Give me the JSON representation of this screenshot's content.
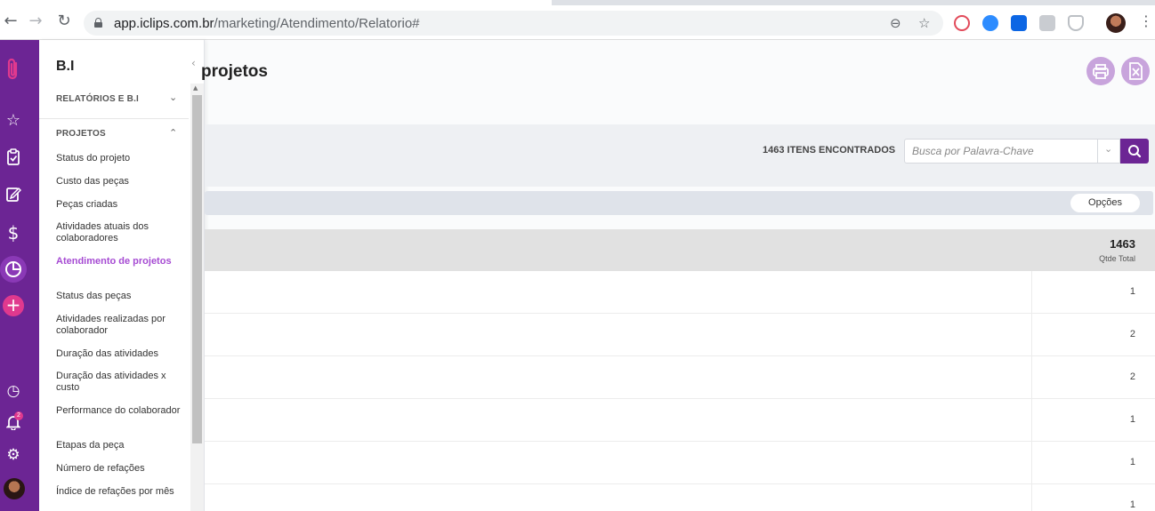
{
  "browser": {
    "url_host": "app.iclips.com.br",
    "url_path": "/marketing/Atendimento/Relatorio#"
  },
  "rail": {
    "icons": [
      "paperclip-logo-icon",
      "star-icon",
      "clipboard-check-icon",
      "edit-icon",
      "dollar-icon",
      "pie-chart-icon",
      "plus-icon",
      "clock-icon",
      "bell-icon",
      "gear-icon",
      "user-avatar"
    ],
    "notifications_count": "2"
  },
  "panel": {
    "title": "B.I",
    "sections": [
      {
        "label": "RELATÓRIOS E B.I"
      },
      {
        "label": "PROJETOS"
      }
    ],
    "items": [
      "Status do projeto",
      "Custo das peças",
      "Peças criadas",
      "Atividades atuais dos colaboradores",
      "Atendimento de projetos",
      "Status das peças",
      "Atividades realizadas por colaborador",
      "Duração das atividades",
      "Duração das atividades x custo",
      "Performance do colaborador",
      "Etapas da peça",
      "Número de refações",
      "Índice de refações por mês"
    ],
    "active_item": "Atendimento de projetos"
  },
  "main": {
    "heading": "projetos",
    "items_found": "1463 ITENS ENCONTRADOS",
    "search_placeholder": "Busca por Palavra-Chave",
    "options_label": "Opções",
    "table": {
      "total_value": "1463",
      "total_label": "Qtde Total",
      "rows": [
        "1",
        "2",
        "2",
        "1",
        "1",
        "1"
      ]
    }
  },
  "colors": {
    "rail": "#6c2594",
    "accent": "#a64bd3",
    "pink": "#e0398e"
  }
}
